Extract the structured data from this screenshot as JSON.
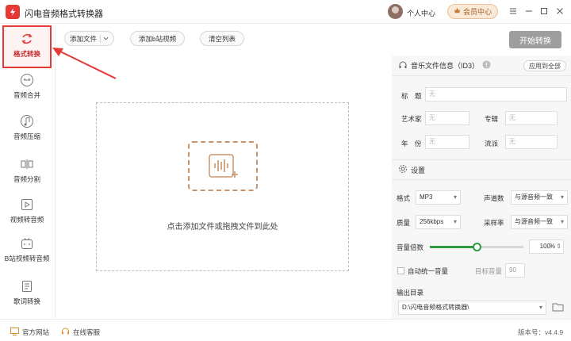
{
  "app": {
    "title": "闪电音频格式转换器"
  },
  "header": {
    "user_label": "个人中心",
    "vip_label": "会员中心",
    "window_controls": [
      "menu-icon",
      "minimize-icon",
      "maximize-icon",
      "close-icon"
    ]
  },
  "sidebar": {
    "items": [
      {
        "label": "格式转换",
        "icon": "convert-icon",
        "active": true
      },
      {
        "label": "音频合并",
        "icon": "merge-icon"
      },
      {
        "label": "音频压缩",
        "icon": "compress-icon"
      },
      {
        "label": "音频分割",
        "icon": "split-icon"
      },
      {
        "label": "视频转音频",
        "icon": "video-to-audio-icon"
      },
      {
        "label": "B站视频转音频",
        "icon": "bilibili-icon"
      },
      {
        "label": "歌词转换",
        "icon": "lyrics-icon"
      }
    ]
  },
  "toolbar": {
    "add_file": "添加文件",
    "add_bilibili": "添加b站视频",
    "clear_list": "清空列表",
    "start": "开始转换"
  },
  "dropzone": {
    "hint": "点击添加文件或拖拽文件到此处"
  },
  "id3": {
    "title": "音乐文件信息（ID3）",
    "apply_all": "应用到全部",
    "fields": [
      {
        "label": "标　题",
        "placeholder": "无"
      },
      {
        "label": "艺术家",
        "placeholder": "无"
      },
      {
        "label": "专辑",
        "placeholder": "无"
      },
      {
        "label": "年　份",
        "placeholder": "无"
      },
      {
        "label": "流派",
        "placeholder": "无"
      }
    ]
  },
  "settings": {
    "title": "设置",
    "format_label": "格式",
    "format_value": "MP3",
    "channels_label": "声道数",
    "channels_value": "与源音频一致",
    "quality_label": "质量",
    "quality_value": "256kbps",
    "samplerate_label": "采样率",
    "samplerate_value": "与源音频一致",
    "volume_label": "音量倍数",
    "volume_value": "100",
    "volume_unit": "%",
    "volume_level_fraction": 0.5,
    "unify_label": "自动统一音量",
    "target_label": "目标音量",
    "target_value": "90",
    "output_label": "输出目录",
    "output_path": "D:\\闪电音频格式转换器\\"
  },
  "statusbar": {
    "website": "官方网站",
    "support": "在线客服",
    "version": "版本号：v4.4.9"
  },
  "colors": {
    "accent_red": "#e53935",
    "slider_green": "#2e9b3c",
    "icon_brown": "#c8956b",
    "start_button": "#9e9e9e"
  }
}
